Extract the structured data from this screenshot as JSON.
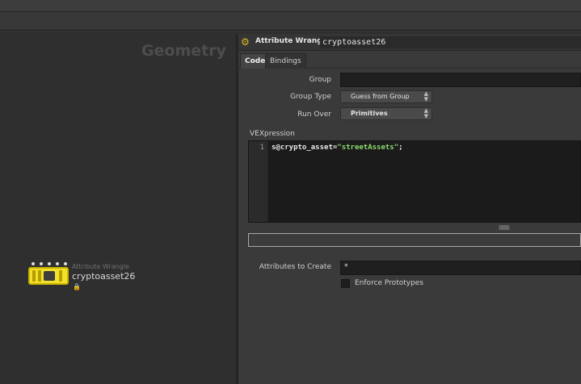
{
  "network": {
    "title": "Geometry",
    "node": {
      "type": "Attribute Wrangle",
      "name": "cryptoasset26",
      "lock_icon": "lock-icon"
    }
  },
  "params": {
    "header": {
      "type": "Attribute Wrangle",
      "name": "cryptoasset26",
      "icon": "wrangle-icon"
    },
    "tabs": [
      "Code",
      "Bindings"
    ],
    "active_tab": "Code",
    "group_label": "Group",
    "group_value": "",
    "group_type_label": "Group Type",
    "group_type_value": "Guess from Group",
    "run_over_label": "Run Over",
    "run_over_value": "Primitives",
    "vex_label": "VEXpression",
    "code": {
      "line_number": "1",
      "attr": "s@crypto_asset",
      "equals": "=",
      "string": "\"streetAssets\"",
      "end": ";"
    },
    "attributes_label": "Attributes to Create",
    "attributes_value": "*",
    "enforce_label": "Enforce Prototypes"
  },
  "colors": {
    "node_fill": "#f2e12a",
    "string_token": "#8bdc6e",
    "panel_bg": "#3a3a3a"
  }
}
